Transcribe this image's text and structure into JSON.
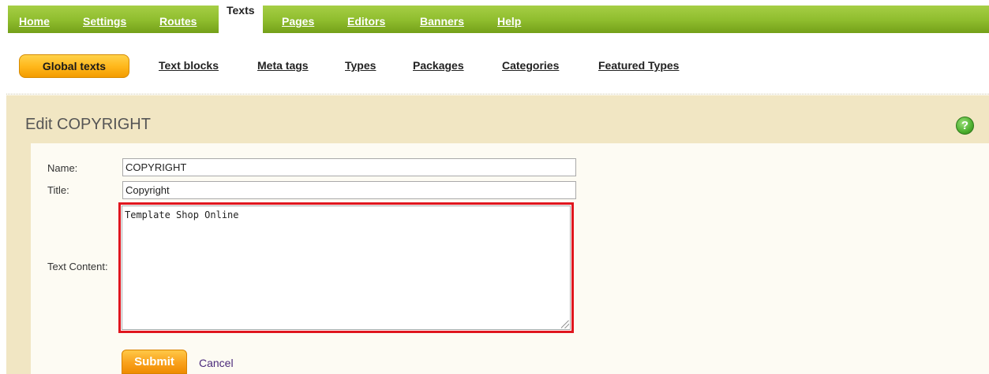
{
  "topnav": {
    "items": [
      {
        "label": "Home",
        "active": false
      },
      {
        "label": "Settings",
        "active": false
      },
      {
        "label": "Routes",
        "active": false
      },
      {
        "label": "Texts",
        "active": true
      },
      {
        "label": "Pages",
        "active": false
      },
      {
        "label": "Editors",
        "active": false
      },
      {
        "label": "Banners",
        "active": false
      },
      {
        "label": "Help",
        "active": false
      }
    ]
  },
  "subnav": {
    "items": [
      {
        "label": "Global texts",
        "active": true
      },
      {
        "label": "Text blocks",
        "active": false
      },
      {
        "label": "Meta tags",
        "active": false
      },
      {
        "label": "Types",
        "active": false
      },
      {
        "label": "Packages",
        "active": false
      },
      {
        "label": "Categories",
        "active": false
      },
      {
        "label": "Featured Types",
        "active": false
      }
    ]
  },
  "panel": {
    "title": "Edit COPYRIGHT",
    "help_icon": "help-question-icon"
  },
  "form": {
    "name_label": "Name:",
    "name_value": "COPYRIGHT",
    "title_label": "Title:",
    "title_value": "Copyright",
    "content_label": "Text Content:",
    "content_value": "Template Shop Online",
    "submit_label": "Submit",
    "cancel_label": "Cancel"
  },
  "colors": {
    "nav_green": "#8ebc2d",
    "accent_orange": "#f9a11c",
    "panel_beige": "#f1e6c3",
    "highlight_red": "#e0161e"
  }
}
